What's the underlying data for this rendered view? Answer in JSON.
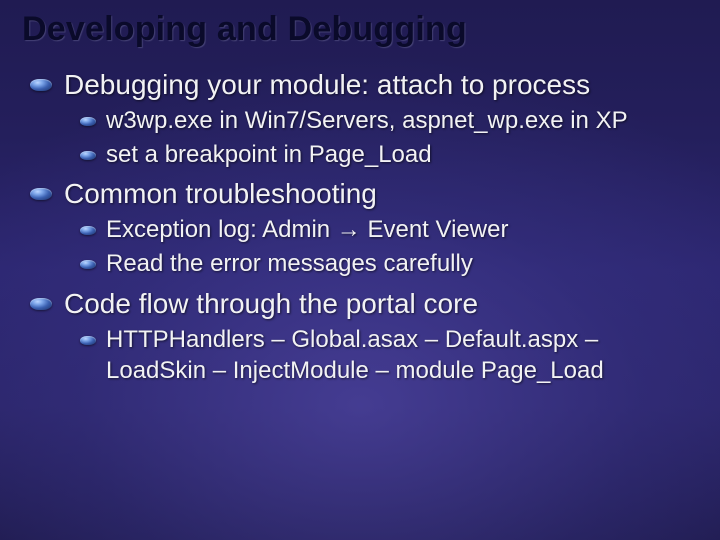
{
  "title": "Developing and Debugging",
  "sections": [
    {
      "heading": "Debugging your module: attach to process",
      "items": [
        "w3wp.exe in Win7/Servers, aspnet_wp.exe in XP",
        "set a breakpoint in Page_Load"
      ]
    },
    {
      "heading": "Common troubleshooting",
      "items": [
        "Exception log: Admin → Event Viewer",
        "Read the error messages carefully"
      ]
    },
    {
      "heading": "Code flow through the portal core",
      "items": [
        "HTTPHandlers – Global.asax – Default.aspx – LoadSkin – InjectModule – module Page_Load"
      ]
    }
  ]
}
